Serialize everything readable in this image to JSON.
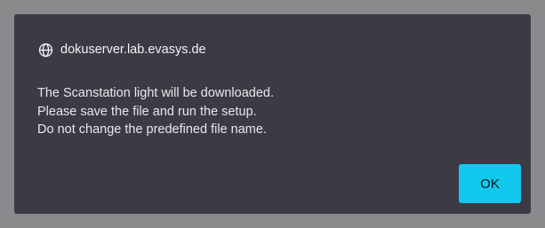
{
  "dialog": {
    "origin": "dokuserver.lab.evasys.de",
    "origin_icon": "globe-icon",
    "message_lines": [
      "The Scanstation light will be downloaded.",
      "Please save the file and run the setup.",
      "Do not change the predefined file name."
    ],
    "ok_label": "OK"
  },
  "colors": {
    "backdrop": "#8a8a8d",
    "dialog_background": "#3b3a45",
    "text": "#e8e8ea",
    "accent_button": "#12c9ed"
  }
}
